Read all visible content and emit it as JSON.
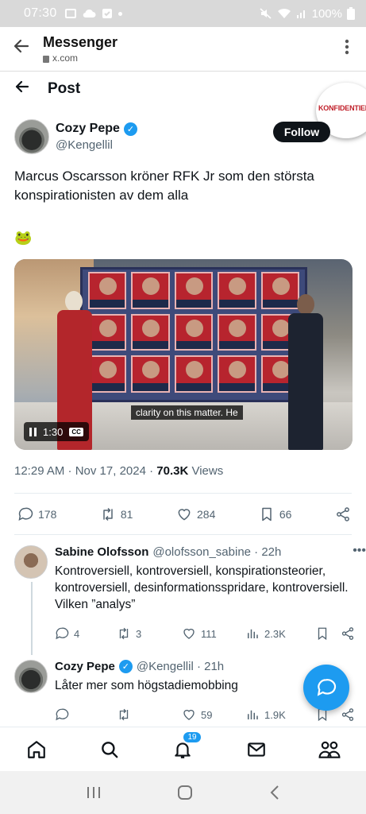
{
  "status_bar": {
    "time": "07:30",
    "battery": "100%",
    "icons": [
      "image-icon",
      "cloud-icon",
      "checkbox-icon",
      "dot-icon",
      "mute-icon",
      "wifi-icon",
      "signal-icon",
      "battery-icon"
    ]
  },
  "app_bar": {
    "title": "Messenger",
    "domain": "x.com"
  },
  "post_header": {
    "title": "Post"
  },
  "sticker": {
    "text": "KONFIDENTIELL"
  },
  "tweet": {
    "author_name": "Cozy Pepe",
    "author_handle": "@Kengellil",
    "follow_label": "Follow",
    "text": "Marcus Oscarsson kröner RFK Jr som den största konspirationisten av dem alla",
    "emoji": "🐸",
    "video": {
      "caption": "clarity on this matter. He",
      "timestamp": "1:30",
      "cc_label": "CC"
    },
    "meta": {
      "datetime": "12:29 AM · Nov 17, 2024 · ",
      "views_count": "70.3K",
      "views_label": " Views"
    },
    "stats": {
      "replies": "178",
      "reposts": "81",
      "likes": "284",
      "bookmarks": "66"
    }
  },
  "replies": [
    {
      "name": "Sabine Olofsson",
      "handle_time": "@olofsson_sabine · 22h",
      "text": "Kontroversiell, kontroversiell, konspirationsteorier, kontroversiell, desinformationsspridare, kontroversiell. Vilken ”analys”",
      "replies": "4",
      "reposts": "3",
      "likes": "111",
      "views": "2.3K"
    },
    {
      "name": "Cozy Pepe",
      "handle_time": "@Kengellil · 21h",
      "text": "Låter mer som högstadiemobbing",
      "replies": "",
      "reposts": "",
      "likes": "59",
      "views": "1.9K"
    }
  ],
  "bottom_nav": {
    "notifications_badge": "19"
  },
  "colors": {
    "accent": "#1d9bf0",
    "text": "#0f1419",
    "muted": "#536471"
  }
}
